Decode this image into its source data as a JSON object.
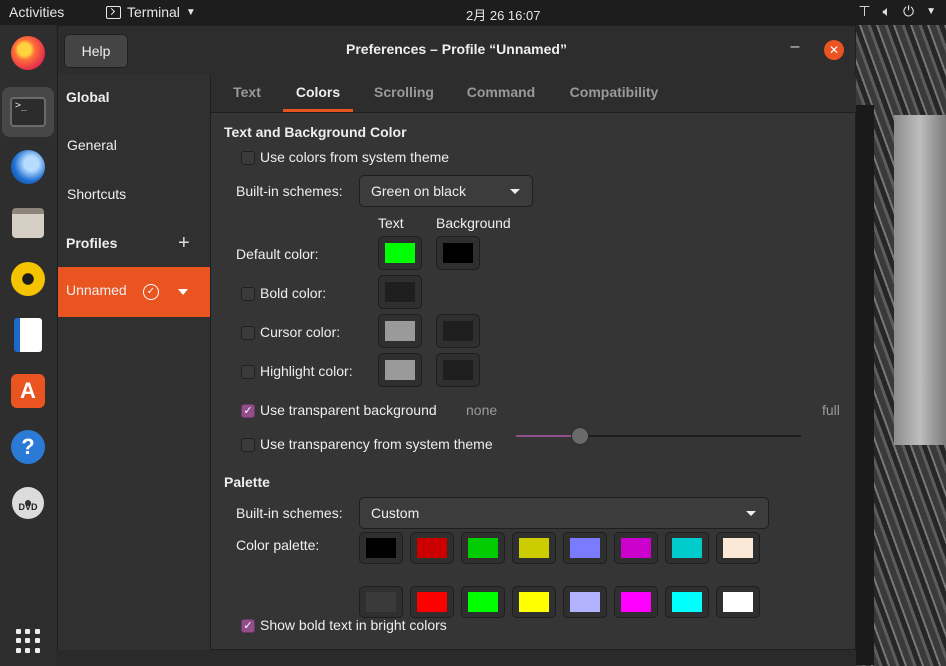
{
  "topbar": {
    "activities": "Activities",
    "app_name": "Terminal",
    "clock": "2月 26  16:07"
  },
  "window": {
    "help_label": "Help",
    "title": "Preferences – Profile “Unnamed”",
    "minimize_glyph": "–",
    "close_glyph": "✕"
  },
  "sidebar": {
    "global": "Global",
    "general": "General",
    "shortcuts": "Shortcuts",
    "profiles": "Profiles",
    "add_glyph": "+",
    "profile_name": "Unnamed"
  },
  "tabs": [
    "Text",
    "Colors",
    "Scrolling",
    "Command",
    "Compatibility"
  ],
  "active_tab": "Colors",
  "colors": {
    "section_title": "Text and Background Color",
    "use_system_colors": {
      "label": "Use colors from system theme",
      "checked": false
    },
    "builtin_label": "Built-in schemes:",
    "builtin_value": "Green on black",
    "col_text": "Text",
    "col_background": "Background",
    "default_color": {
      "label": "Default color:",
      "text": "#00ff00",
      "background": "#000000"
    },
    "bold_color": {
      "label": "Bold color:",
      "checked": false,
      "text": "#1e1e1e"
    },
    "cursor_color": {
      "label": "Cursor color:",
      "checked": false,
      "text": "#9a9a9a",
      "background": "#1e1e1e"
    },
    "highlight_color": {
      "label": "Highlight color:",
      "checked": false,
      "text": "#9a9a9a",
      "background": "#1e1e1e"
    },
    "transparent_bg": {
      "label": "Use transparent background",
      "checked": true,
      "min_label": "none",
      "max_label": "full",
      "value_fraction": 0.22
    },
    "transparency_system": {
      "label": "Use transparency from system theme",
      "checked": false
    }
  },
  "palette": {
    "section_title": "Palette",
    "builtin_label": "Built-in schemes:",
    "builtin_value": "Custom",
    "palette_label": "Color palette:",
    "row1": [
      "#000000",
      "#cc0000",
      "#00cc00",
      "#cccc00",
      "#7b7bff",
      "#cc00cc",
      "#00cccc",
      "#fbe9d8"
    ],
    "row2": [
      "#3a3a3a",
      "#ff0000",
      "#00ff00",
      "#ffff00",
      "#b2b2ff",
      "#ff00ff",
      "#00ffff",
      "#ffffff"
    ],
    "show_bold_bright": {
      "label": "Show bold text in bright colors",
      "checked": true
    }
  },
  "accent": "#e95420",
  "check_accent": "#924d8b"
}
